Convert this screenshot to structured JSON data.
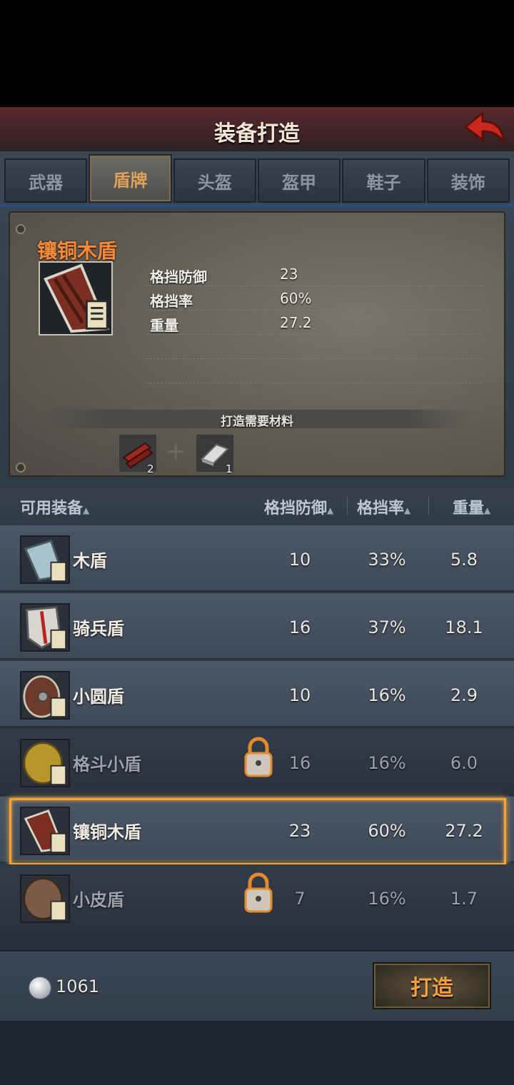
{
  "header": {
    "title": "装备打造"
  },
  "tabs": [
    {
      "label": "武器"
    },
    {
      "label": "盾牌",
      "active": true
    },
    {
      "label": "头盔"
    },
    {
      "label": "盔甲"
    },
    {
      "label": "鞋子"
    },
    {
      "label": "装饰"
    }
  ],
  "detail": {
    "name": "镶铜木盾",
    "stats": [
      {
        "label": "格挡防御",
        "value": "23"
      },
      {
        "label": "格挡率",
        "value": "60%"
      },
      {
        "label": "重量",
        "value": "27.2"
      }
    ],
    "materials_title": "打造需要材料",
    "materials": [
      {
        "icon": "wood-planks-icon",
        "count": "2"
      },
      {
        "icon": "iron-ingot-icon",
        "count": "1"
      }
    ],
    "plus_symbol": "+"
  },
  "list": {
    "headers": {
      "name": "可用装备",
      "block_def": "格挡防御",
      "block_rate": "格挡率",
      "weight": "重量",
      "sort_arrow": "▲"
    },
    "rows": [
      {
        "name": "木盾",
        "block_def": "10",
        "block_rate": "33%",
        "weight": "5.8",
        "locked": false
      },
      {
        "name": "骑兵盾",
        "block_def": "16",
        "block_rate": "37%",
        "weight": "18.1",
        "locked": false
      },
      {
        "name": "小圆盾",
        "block_def": "10",
        "block_rate": "16%",
        "weight": "2.9",
        "locked": false
      },
      {
        "name": "格斗小盾",
        "block_def": "16",
        "block_rate": "16%",
        "weight": "6.0",
        "locked": true
      },
      {
        "name": "镶铜木盾",
        "block_def": "23",
        "block_rate": "60%",
        "weight": "27.2",
        "locked": false,
        "selected": true
      },
      {
        "name": "小皮盾",
        "block_def": "7",
        "block_rate": "16%",
        "weight": "1.7",
        "locked": true
      }
    ]
  },
  "footer": {
    "silver": "1061",
    "forge_label": "打造"
  },
  "colors": {
    "accent": "#f08a3c",
    "selection": "#f0a43a",
    "tab_underline": "#2a4e7a"
  }
}
